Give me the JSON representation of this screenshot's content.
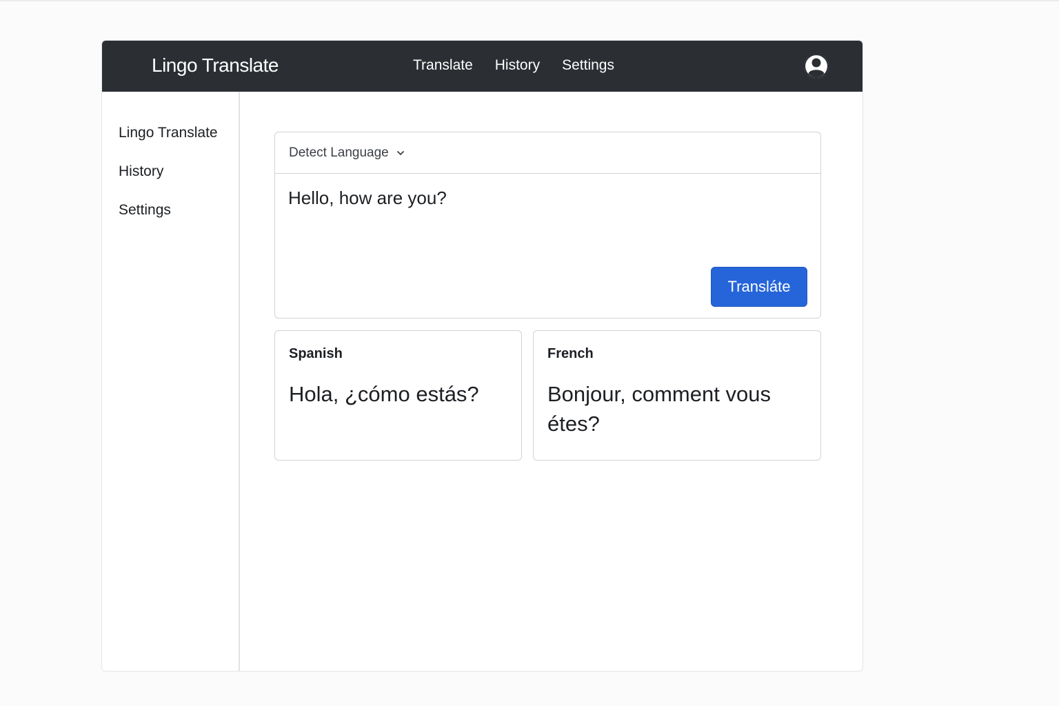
{
  "header": {
    "brand": "Lingo Translate",
    "nav": [
      {
        "label": "Translate"
      },
      {
        "label": "History"
      },
      {
        "label": "Settings"
      }
    ],
    "avatar_icon": "user-circle-icon"
  },
  "sidebar": {
    "items": [
      {
        "label": "Lingo Translate"
      },
      {
        "label": "History"
      },
      {
        "label": "Settings"
      }
    ]
  },
  "input": {
    "source_language": "Detect Language",
    "text": "Hello, how are you?",
    "translate_label": "Transláte"
  },
  "results": [
    {
      "language": "Spanish",
      "text": "Hola, ¿cómo estás?"
    },
    {
      "language": "French",
      "text": "Bonjour, comment vous étes?"
    }
  ],
  "colors": {
    "navbar": "#2b2f34",
    "accent": "#2665d9"
  }
}
